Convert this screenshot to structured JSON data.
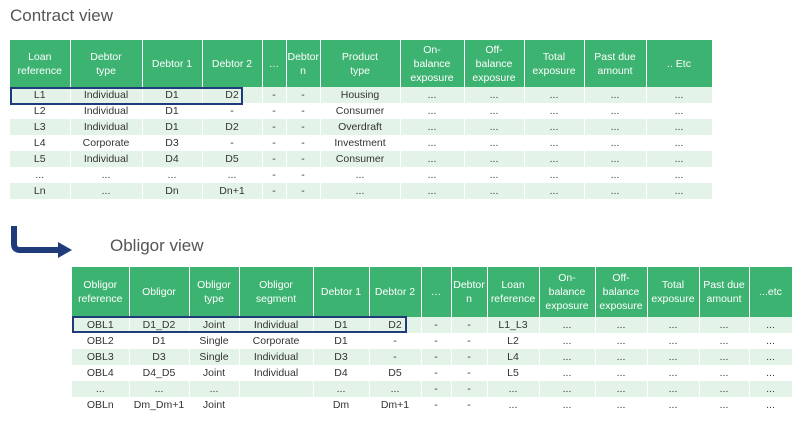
{
  "contract": {
    "title": "Contract view",
    "headers": [
      "Loan\nreference",
      "Debtor\ntype",
      "Debtor 1",
      "Debtor 2",
      "…",
      "Debtor\nn",
      "Product\ntype",
      "On-\nbalance\nexposure",
      "Off-\nbalance\nexposure",
      "Total\nexposure",
      "Past due\namount",
      ".. Etc"
    ],
    "rows": [
      [
        "L1",
        "Individual",
        "D1",
        "D2",
        "-",
        "-",
        "Housing",
        "...",
        "...",
        "...",
        "...",
        "..."
      ],
      [
        "L2",
        "Individual",
        "D1",
        "-",
        "-",
        "-",
        "Consumer",
        "...",
        "...",
        "...",
        "...",
        "..."
      ],
      [
        "L3",
        "Individual",
        "D1",
        "D2",
        "-",
        "-",
        "Overdraft",
        "...",
        "...",
        "...",
        "...",
        "..."
      ],
      [
        "L4",
        "Corporate",
        "D3",
        "-",
        "-",
        "-",
        "Investment",
        "...",
        "...",
        "...",
        "...",
        "..."
      ],
      [
        "L5",
        "Individual",
        "D4",
        "D5",
        "-",
        "-",
        "Consumer",
        "...",
        "...",
        "...",
        "...",
        "..."
      ],
      [
        "...",
        "...",
        "...",
        "...",
        "-",
        "-",
        "...",
        "...",
        "...",
        "...",
        "...",
        "..."
      ],
      [
        "Ln",
        "...",
        "Dn",
        "Dn+1",
        "-",
        "-",
        "...",
        "...",
        "...",
        "...",
        "...",
        "..."
      ]
    ]
  },
  "obligor": {
    "title": "Obligor view",
    "headers": [
      "Obligor\nreference",
      "Obligor",
      "Obligor\ntype",
      "Obligor\nsegment",
      "Debtor 1",
      "Debtor 2",
      "…",
      "Debtor\nn",
      "Loan\nreference",
      "On-\nbalance\nexposure",
      "Off-\nbalance\nexposure",
      "Total\nexposure",
      "Past due\namount",
      "...etc"
    ],
    "rows": [
      [
        "OBL1",
        "D1_D2",
        "Joint",
        "Individual",
        "D1",
        "D2",
        "-",
        "-",
        "L1_L3",
        "...",
        "...",
        "...",
        "...",
        "..."
      ],
      [
        "OBL2",
        "D1",
        "Single",
        "Corporate",
        "D1",
        "-",
        "-",
        "-",
        "L2",
        "...",
        "...",
        "...",
        "...",
        "..."
      ],
      [
        "OBL3",
        "D3",
        "Single",
        "Individual",
        "D3",
        "-",
        "-",
        "-",
        "L4",
        "...",
        "...",
        "...",
        "...",
        "..."
      ],
      [
        "OBL4",
        "D4_D5",
        "Joint",
        "Individual",
        "D4",
        "D5",
        "-",
        "-",
        "L5",
        "...",
        "...",
        "...",
        "...",
        "..."
      ],
      [
        "...",
        "...",
        "...",
        "",
        "...",
        "...",
        "-",
        "-",
        "...",
        "...",
        "...",
        "...",
        "...",
        "..."
      ],
      [
        "OBLn",
        "Dm_Dm+1",
        "Joint",
        "",
        "Dm",
        "Dm+1",
        "-",
        "-",
        "...",
        "...",
        "...",
        "...",
        "...",
        "..."
      ]
    ]
  },
  "colors": {
    "header_green": "#3cb371",
    "row_tint": "#e4f3e8",
    "highlight_border": "#1f3b7a",
    "arrow": "#1f3b7a"
  },
  "icons": {
    "arrow": "down-right-turn-arrow-icon"
  }
}
